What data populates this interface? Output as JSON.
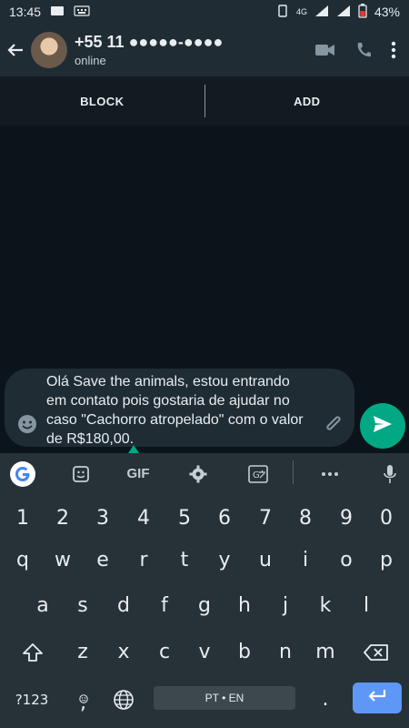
{
  "status_bar": {
    "time": "13:45",
    "network": "4G",
    "battery": "43%"
  },
  "header": {
    "contact_name": "+55 11 ●●●●●-●●●●",
    "contact_status": "online",
    "icons": [
      "back-arrow-icon",
      "avatar",
      "video-call-icon",
      "phone-icon",
      "more-vert-icon"
    ]
  },
  "action_bar": {
    "block_label": "BLOCK",
    "add_label": "ADD"
  },
  "compose": {
    "text": "Olá Save the animals, estou entrando\nem contato pois gostaria de ajudar no\ncaso \"Cachorro atropelado\" com o valor\nde R$180,00."
  },
  "keyboard": {
    "suggestions": [
      "google-icon",
      "sticker-icon",
      "GIF",
      "settings-icon",
      "translate-icon",
      "more-icon",
      "mic-icon"
    ],
    "row_numbers": [
      "1",
      "2",
      "3",
      "4",
      "5",
      "6",
      "7",
      "8",
      "9",
      "0"
    ],
    "row_q": [
      "q",
      "w",
      "e",
      "r",
      "t",
      "y",
      "u",
      "i",
      "o",
      "p"
    ],
    "row_a": [
      "a",
      "s",
      "d",
      "f",
      "g",
      "h",
      "j",
      "k",
      "l"
    ],
    "row_z": [
      "z",
      "x",
      "c",
      "v",
      "b",
      "n",
      "m"
    ],
    "bottom": {
      "symbols": "?123",
      "comma": ",",
      "space_label": "PT • EN",
      "period": "."
    }
  },
  "colors": {
    "accent": "#00a884",
    "enter": "#5e97f6",
    "bar": "#1f2c34",
    "bg": "#0b141a"
  }
}
